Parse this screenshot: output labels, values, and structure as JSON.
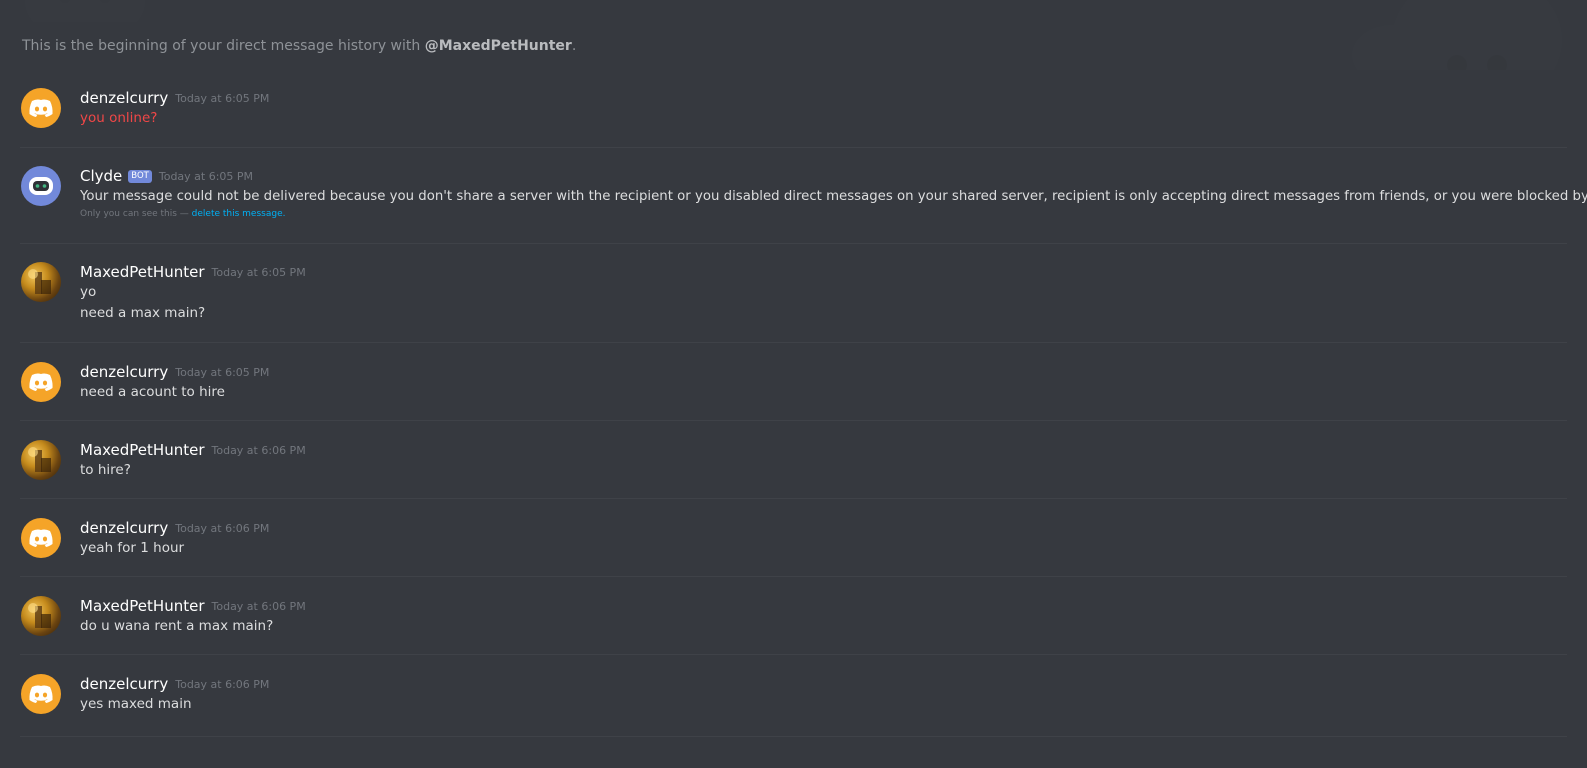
{
  "intro": {
    "prefix": "This is the beginning of your direct message history with ",
    "handle": "@MaxedPetHunter",
    "suffix": "."
  },
  "messages": [
    {
      "avatar": "discord-logo-orange",
      "username": "denzelcurry",
      "timestamp": "Today at 6:05 PM",
      "lines": [
        "you online?"
      ],
      "failed": true
    },
    {
      "avatar": "clyde-bot",
      "username": "Clyde",
      "bot_tag": "BOT",
      "timestamp": "Today at 6:05 PM",
      "lines": [
        "Your message could not be delivered because you don't share a server with the recipient or you disabled direct messages on your shared server, recipient is only accepting direct messages from friends, or you were blocked by the recipient."
      ],
      "ephemeral_text": "Only you can see this — ",
      "ephemeral_link": "delete this message."
    },
    {
      "avatar": "user-photo",
      "username": "MaxedPetHunter",
      "timestamp": "Today at 6:05 PM",
      "lines": [
        "yo",
        "need a max main?"
      ]
    },
    {
      "avatar": "discord-logo-orange",
      "username": "denzelcurry",
      "timestamp": "Today at 6:05 PM",
      "lines": [
        "need a acount to hire"
      ]
    },
    {
      "avatar": "user-photo",
      "username": "MaxedPetHunter",
      "timestamp": "Today at 6:06 PM",
      "lines": [
        "to hire?"
      ]
    },
    {
      "avatar": "discord-logo-orange",
      "username": "denzelcurry",
      "timestamp": "Today at 6:06 PM",
      "lines": [
        "yeah for 1 hour"
      ]
    },
    {
      "avatar": "user-photo",
      "username": "MaxedPetHunter",
      "timestamp": "Today at 6:06 PM",
      "lines": [
        "do u wana rent a max main?"
      ]
    },
    {
      "avatar": "discord-logo-orange",
      "username": "denzelcurry",
      "timestamp": "Today at 6:06 PM",
      "lines": [
        "yes maxed main"
      ]
    }
  ],
  "colors": {
    "background": "#36393f",
    "failed_text": "#f04747",
    "link": "#00b0f4",
    "bot_tag": "#7289da",
    "avatar_orange": "#f5a428"
  }
}
